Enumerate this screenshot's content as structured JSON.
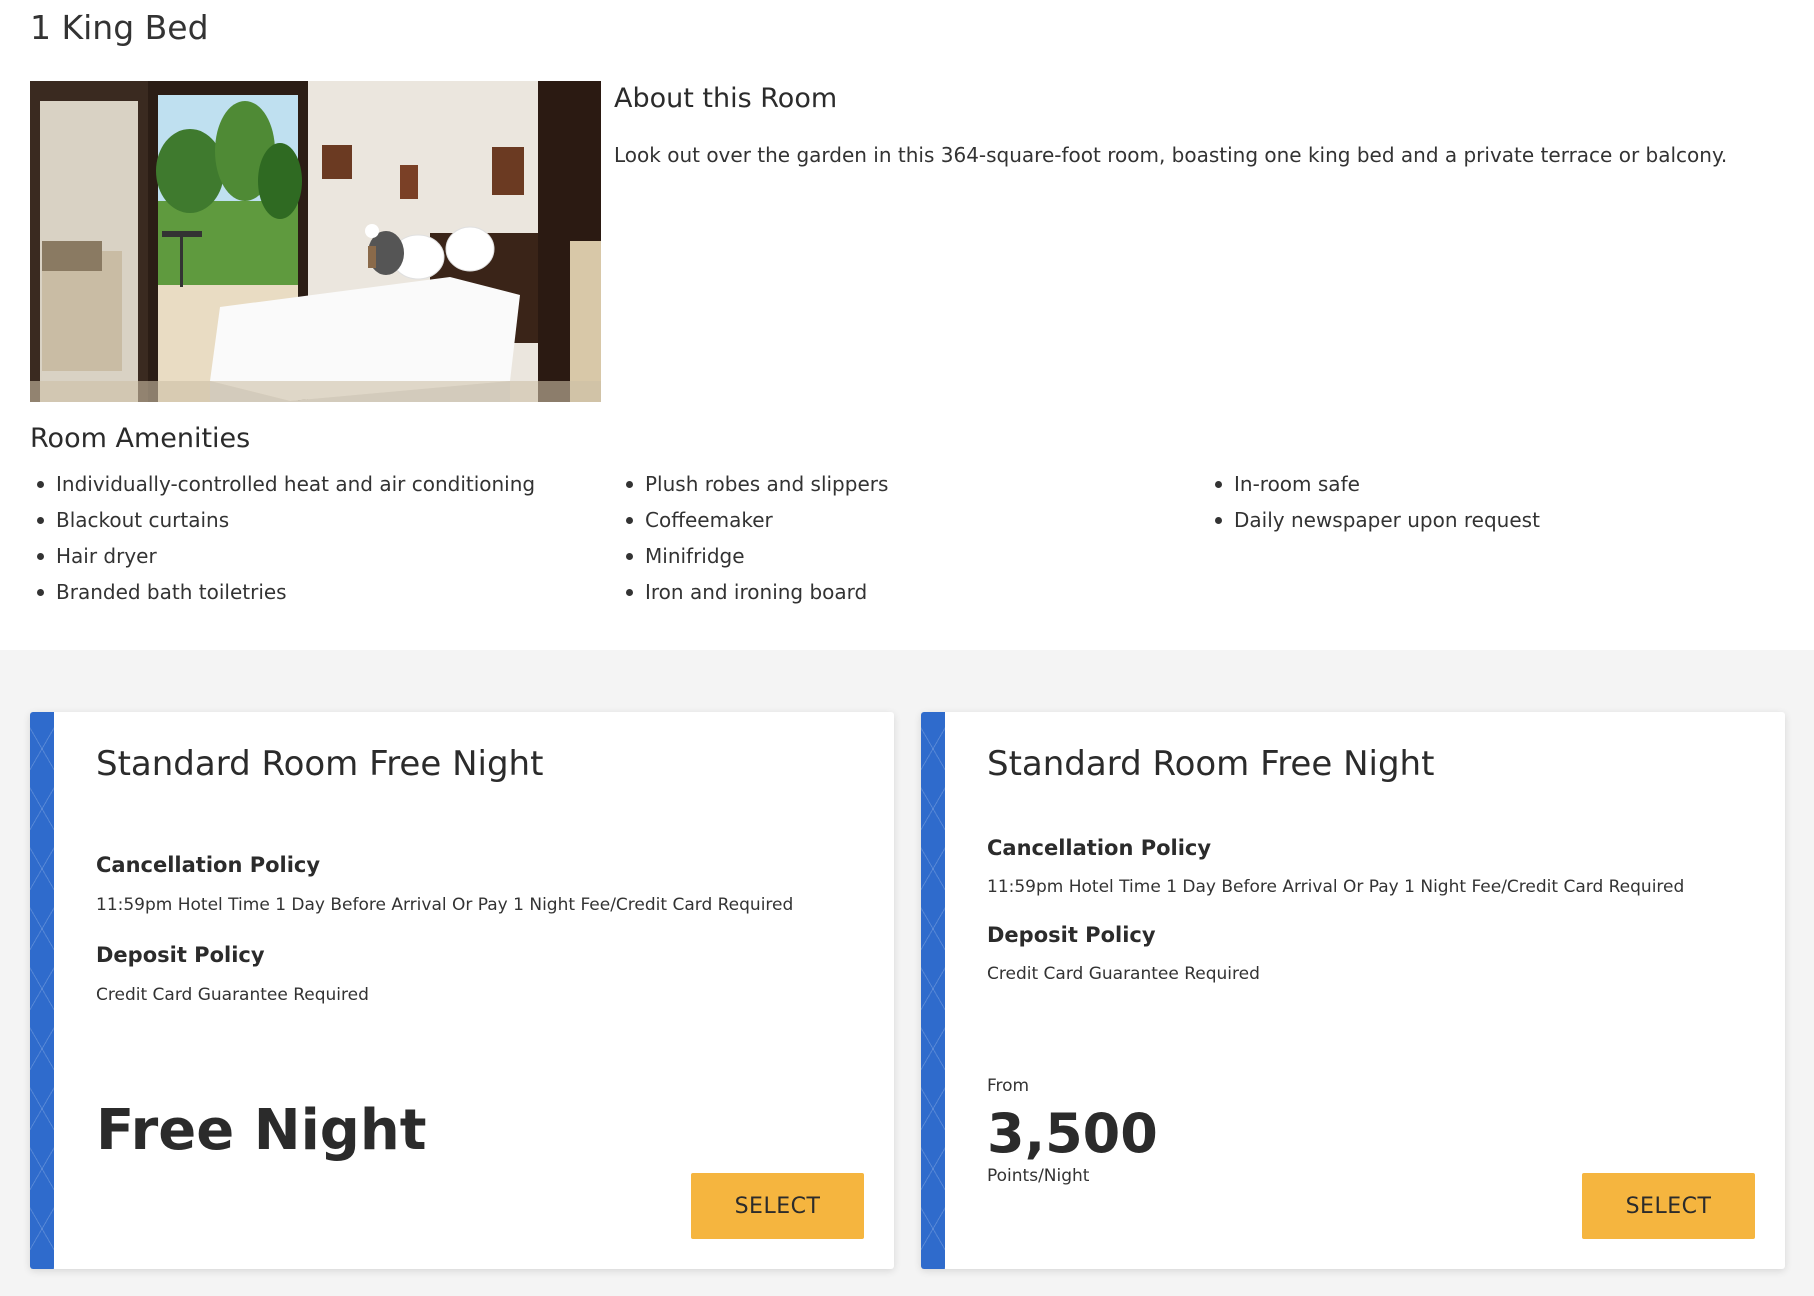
{
  "room": {
    "title": "1 King Bed",
    "photo_alt": "hotel-room-photo"
  },
  "about": {
    "title": "About this Room",
    "description": "Look out over the garden in this 364-square-foot room, boasting one king bed and a private terrace or balcony."
  },
  "amenities": {
    "title": "Room Amenities",
    "columns": [
      [
        "Individually-controlled heat and air conditioning",
        "Blackout curtains",
        "Hair dryer",
        "Branded bath toiletries"
      ],
      [
        "Plush robes and slippers",
        "Coffeemaker",
        "Minifridge",
        "Iron and ironing board"
      ],
      [
        "In-room safe",
        "Daily newspaper upon request"
      ]
    ]
  },
  "rates": [
    {
      "title": "Standard Room Free Night",
      "cancellation_label": "Cancellation Policy",
      "cancellation_text": "11:59pm Hotel Time 1 Day Before Arrival Or Pay 1 Night Fee/Credit Card Required",
      "deposit_label": "Deposit Policy",
      "deposit_text": "Credit Card Guarantee Required",
      "price_text": "Free Night",
      "button_label": "SELECT"
    },
    {
      "title": "Standard Room Free Night",
      "cancellation_label": "Cancellation Policy",
      "cancellation_text": "11:59pm Hotel Time 1 Day Before Arrival Or Pay 1 Night Fee/Credit Card Required",
      "deposit_label": "Deposit Policy",
      "deposit_text": "Credit Card Guarantee Required",
      "from_label": "From",
      "price_value": "3,500",
      "price_unit": "Points/Night",
      "button_label": "SELECT"
    }
  ],
  "colors": {
    "accent_stripe": "#2f6bcc",
    "button": "#f5b53f",
    "section_bg": "#f4f4f4"
  }
}
